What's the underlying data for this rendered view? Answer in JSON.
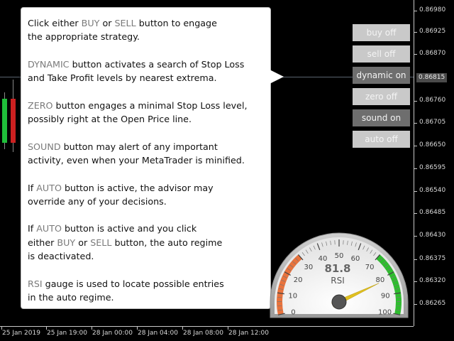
{
  "price_axis": {
    "labels": [
      "0.86980",
      "0.86925",
      "0.86870",
      "0.86760",
      "0.86705",
      "0.86650",
      "0.86595",
      "0.86540",
      "0.86485",
      "0.86430",
      "0.86375",
      "0.86320",
      "0.86265"
    ],
    "current": "0.86815"
  },
  "time_axis": {
    "labels": [
      "25 Jan 2019",
      "25 Jan 19:00",
      "28 Jan 00:00",
      "28 Jan 04:00",
      "28 Jan 08:00",
      "28 Jan 12:00"
    ]
  },
  "tooltip": {
    "p1": {
      "a": "Click either ",
      "k1": "BUY",
      "b": " or ",
      "k2": "SELL",
      "c": " button to engage\nthe appropriate strategy."
    },
    "p2": {
      "k1": "DYNAMIC",
      "a": " button activates a search of Stop Loss\nand Take Profit levels by nearest extrema."
    },
    "p3": {
      "k1": "ZERO",
      "a": " button engages a minimal Stop Loss level,\npossibly right at the Open Price line."
    },
    "p4": {
      "k1": "SOUND",
      "a": " button may alert of any important\nactivity, even when your MetaTrader is minified."
    },
    "p5": {
      "a": "If ",
      "k1": "AUTO",
      "b": " button is active, the advisor may\noverride any of your decisions."
    },
    "p6": {
      "a": "If ",
      "k1": "AUTO",
      "b": " button is active and you click\neither ",
      "k2": "BUY",
      "c": " or ",
      "k3": "SELL",
      "d": " button, the auto regime\nis deactivated."
    },
    "p7": {
      "k1": "RSI",
      "a": " gauge is used to locate possible entries\nin the auto regime."
    }
  },
  "buttons": [
    {
      "label": "buy off",
      "state": "off"
    },
    {
      "label": "sell off",
      "state": "off"
    },
    {
      "label": "dynamic on",
      "state": "on"
    },
    {
      "label": "zero off",
      "state": "off"
    },
    {
      "label": "sound on",
      "state": "on"
    },
    {
      "label": "auto off",
      "state": "off"
    }
  ],
  "gauge": {
    "value": 81.8,
    "value_text": "81.8",
    "label": "RSI",
    "min": 0,
    "max": 100,
    "ticks": [
      "0",
      "10",
      "20",
      "30",
      "40",
      "50",
      "60",
      "70",
      "80",
      "90",
      "100"
    ],
    "low_zone_color": "#e8723c",
    "high_zone_color": "#2ebd2e",
    "needle_color": "#e0c020"
  },
  "colors": {
    "candle_bull": "#1fbe3a",
    "candle_bear": "#cc2020",
    "keyword": "#7a7a7a"
  }
}
